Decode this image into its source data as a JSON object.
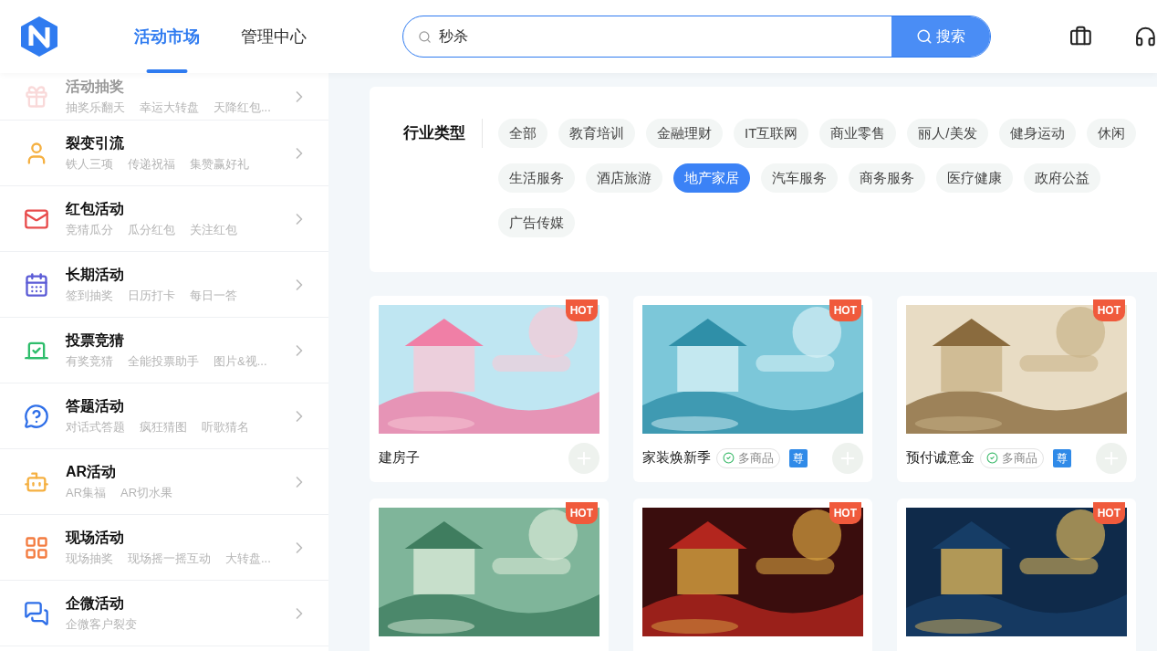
{
  "header": {
    "nav": [
      {
        "label": "活动市场",
        "selected": true
      },
      {
        "label": "管理中心",
        "selected": false
      }
    ],
    "search": {
      "value": "秒杀",
      "button": "搜索"
    }
  },
  "sidebar": {
    "items": [
      {
        "title": "活动抽奖",
        "faded": true,
        "subs": [
          "抽奖乐翻天",
          "幸运大转盘",
          "天降红包..."
        ]
      },
      {
        "title": "裂变引流",
        "faded": false,
        "subs": [
          "铁人三项",
          "传递祝福",
          "集赞赢好礼"
        ]
      },
      {
        "title": "红包活动",
        "faded": false,
        "subs": [
          "竞猜瓜分",
          "瓜分红包",
          "关注红包"
        ]
      },
      {
        "title": "长期活动",
        "faded": false,
        "subs": [
          "签到抽奖",
          "日历打卡",
          "每日一答"
        ]
      },
      {
        "title": "投票竞猜",
        "faded": false,
        "subs": [
          "有奖竞猜",
          "全能投票助手",
          "图片&视..."
        ]
      },
      {
        "title": "答题活动",
        "faded": false,
        "subs": [
          "对话式答题",
          "疯狂猜图",
          "听歌猜名"
        ]
      },
      {
        "title": "AR活动",
        "faded": false,
        "subs": [
          "AR集福",
          "AR切水果"
        ]
      },
      {
        "title": "现场活动",
        "faded": false,
        "subs": [
          "现场抽奖",
          "现场摇一摇互动",
          "大转盘..."
        ]
      },
      {
        "title": "企微活动",
        "faded": false,
        "subs": [
          "企微客户裂变"
        ]
      }
    ]
  },
  "filter": {
    "label": "行业类型",
    "rows": [
      [
        {
          "label": "全部",
          "selected": false
        },
        {
          "label": "教育培训",
          "selected": false
        },
        {
          "label": "金融理财",
          "selected": false
        },
        {
          "label": "IT互联网",
          "selected": false
        },
        {
          "label": "商业零售",
          "selected": false
        },
        {
          "label": "丽人/美发",
          "selected": false
        },
        {
          "label": "健身运动",
          "selected": false
        },
        {
          "label": "休闲",
          "selected": false
        }
      ],
      [
        {
          "label": "生活服务",
          "selected": false
        },
        {
          "label": "酒店旅游",
          "selected": false
        },
        {
          "label": "地产家居",
          "selected": true
        },
        {
          "label": "汽车服务",
          "selected": false
        },
        {
          "label": "商务服务",
          "selected": false
        },
        {
          "label": "医疗健康",
          "selected": false
        },
        {
          "label": "政府公益",
          "selected": false
        }
      ],
      [
        {
          "label": "广告传媒",
          "selected": false
        }
      ]
    ]
  },
  "cards": [
    {
      "badge": "HOT",
      "title": "建房子"
    },
    {
      "badge": "HOT",
      "title": "家装焕新季",
      "tag": "多商品",
      "vip": "尊"
    },
    {
      "badge": "HOT",
      "title": "预付诚意金",
      "tag": "多商品",
      "vip": "尊"
    },
    {
      "badge": "HOT"
    },
    {
      "badge": "HOT"
    },
    {
      "badge": "HOT"
    }
  ]
}
